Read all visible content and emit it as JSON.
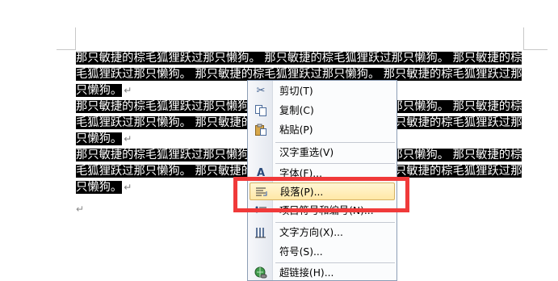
{
  "document": {
    "lines": [
      {
        "text": "那只敏捷的棕毛狐狸跃过那只懒狗。 那只敏捷的棕毛狐狸跃过那只懒狗。 那只敏捷的棕",
        "mark": ""
      },
      {
        "text": "毛狐狸跃过那只懒狗。 那只敏捷的棕毛狐狸跃过那只懒狗。 那只敏捷的棕毛狐狸跃过那",
        "mark": ""
      },
      {
        "text": "只懒狗。",
        "mark": "↵"
      },
      {
        "text": "那只敏捷的棕毛狐狸跃过那只懒狗。 那只敏捷的棕毛狐狸跃过那只懒狗。 那只敏捷的棕",
        "mark": ""
      },
      {
        "text": "毛狐狸跃过那只懒狗。 那只敏捷的棕毛狐狸跃过那只懒狗。 那只敏捷的棕毛狐狸跃过那",
        "mark": ""
      },
      {
        "text": "只懒狗。",
        "mark": "↵"
      },
      {
        "text": "那只敏捷的棕毛狐狸跃过那只懒狗。 那只敏捷的棕毛狐狸跃过那只懒狗。 那只敏捷的棕",
        "mark": ""
      },
      {
        "text": "毛狐狸跃过那只懒狗。 那只敏捷的棕毛狐狸跃过那只懒狗。 那只敏捷的棕毛狐狸跃过那",
        "mark": ""
      },
      {
        "text": "只懒狗。",
        "mark": "↵"
      }
    ],
    "empty_paragraph_mark": "↵"
  },
  "context_menu": {
    "items": [
      {
        "label": "剪切(T)",
        "icon": "cut-icon"
      },
      {
        "label": "复制(C)",
        "icon": "copy-icon"
      },
      {
        "label": "粘贴(P)",
        "icon": "paste-icon"
      },
      {
        "label": "汉字重选(V)",
        "icon": ""
      },
      {
        "label": "字体(F)...",
        "icon": "font-icon"
      },
      {
        "label": "段落(P)...",
        "icon": "paragraph-icon",
        "highlighted": true
      },
      {
        "label": "项目符号和编号(N)...",
        "icon": "bullets-icon"
      },
      {
        "label": "文字方向(X)...",
        "icon": "text-direction-icon"
      },
      {
        "label": "符号(S)...",
        "icon": ""
      },
      {
        "label": "超链接(H)...",
        "icon": "hyperlink-icon"
      }
    ],
    "highlight_color": "#ffe8a6"
  },
  "annotation": {
    "color": "#f03a3a"
  }
}
